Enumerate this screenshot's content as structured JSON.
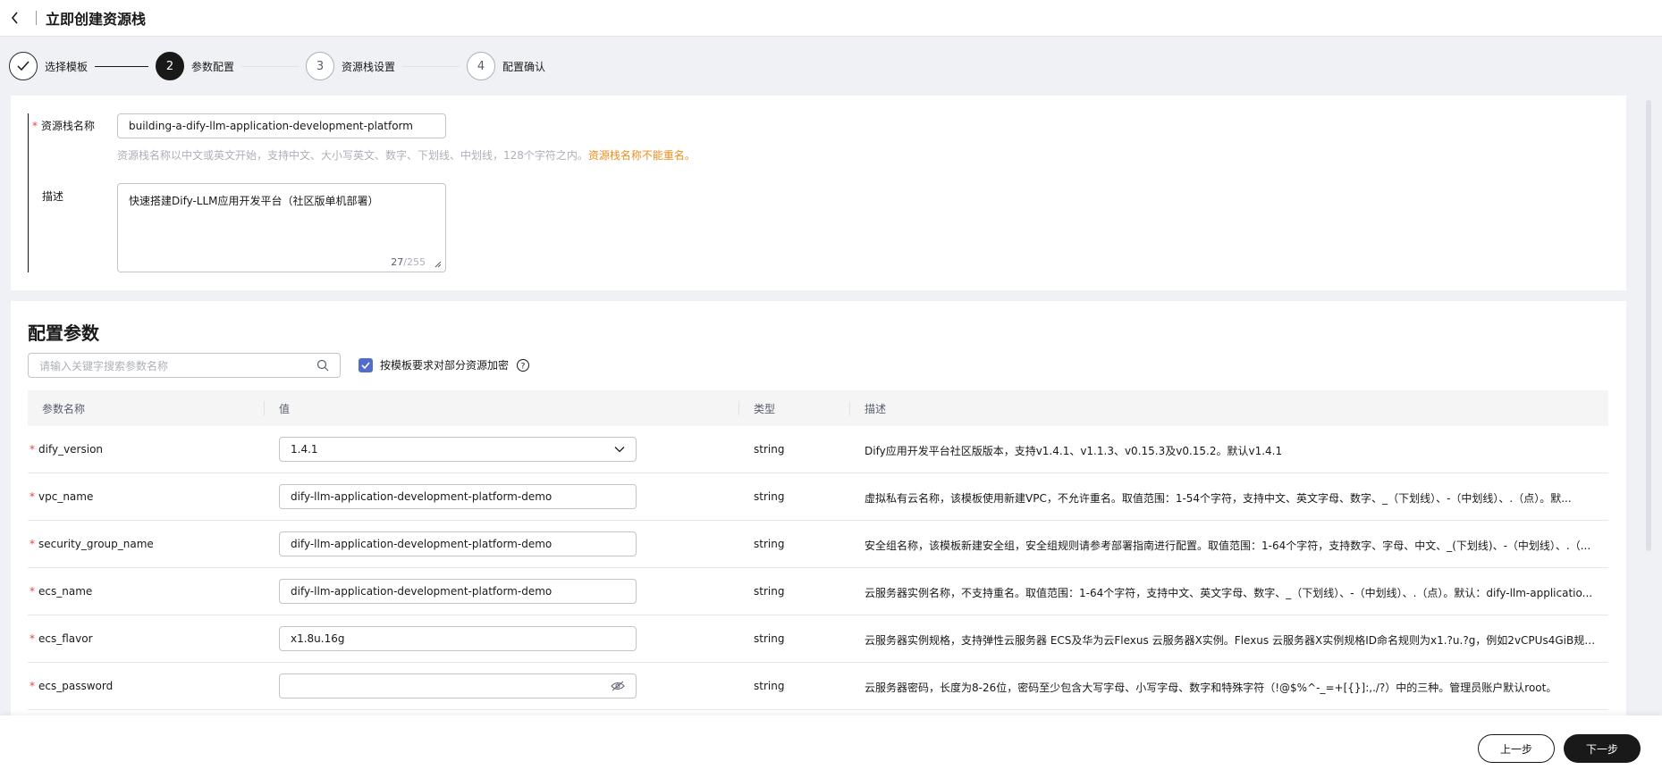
{
  "header": {
    "title": "立即创建资源栈"
  },
  "steps": [
    {
      "label": "选择模板",
      "num": ""
    },
    {
      "label": "参数配置",
      "num": "2"
    },
    {
      "label": "资源栈设置",
      "num": "3"
    },
    {
      "label": "配置确认",
      "num": "4"
    }
  ],
  "basic": {
    "name_label": "资源栈名称",
    "name_value": "building-a-dify-llm-application-development-platform",
    "name_hint": "资源栈名称以中文或英文开始，支持中文、大小写英文、数字、下划线、中划线，128个字符之内。",
    "name_hint_warn": "资源栈名称不能重名。",
    "desc_label": "描述",
    "desc_value": "快速搭建Dify-LLM应用开发平台（社区版单机部署）",
    "desc_count": "27",
    "desc_max": "/255"
  },
  "params": {
    "title": "配置参数",
    "search_placeholder": "请输入关键字搜索参数名称",
    "encrypt_label": "按模板要求对部分资源加密",
    "columns": {
      "name": "参数名称",
      "value": "值",
      "type": "类型",
      "desc": "描述"
    },
    "rows": [
      {
        "name": "dify_version",
        "value": "1.4.1",
        "type": "string",
        "desc": "Dify应用开发平台社区版版本，支持v1.4.1、v1.1.3、v0.15.3及v0.15.2。默认v1.4.1"
      },
      {
        "name": "vpc_name",
        "value": "dify-llm-application-development-platform-demo",
        "type": "string",
        "desc": "虚拟私有云名称，该模板使用新建VPC，不允许重名。取值范围：1-54个字符，支持中文、英文字母、数字、_（下划线）、-（中划线）、.（点）。默..."
      },
      {
        "name": "security_group_name",
        "value": "dify-llm-application-development-platform-demo",
        "type": "string",
        "desc": "安全组名称，该模板新建安全组，安全组规则请参考部署指南进行配置。取值范围：1-64个字符，支持数字、字母、中文、_(下划线)、-（中划线）、.（..."
      },
      {
        "name": "ecs_name",
        "value": "dify-llm-application-development-platform-demo",
        "type": "string",
        "desc": "云服务器实例名称，不支持重名。取值范围：1-64个字符，支持中文、英文字母、数字、_（下划线）、-（中划线）、.（点）。默认：dify-llm-applicatio..."
      },
      {
        "name": "ecs_flavor",
        "value": "x1.8u.16g",
        "type": "string",
        "desc": "云服务器实例规格，支持弹性云服务器 ECS及华为云Flexus 云服务器X实例。Flexus 云服务器X实例规格ID命名规则为x1.?u.?g，例如2vCPUs4GiB规格..."
      },
      {
        "name": "ecs_password",
        "value": "",
        "type": "string",
        "desc": "云服务器密码，长度为8-26位，密码至少包含大写字母、小写字母、数字和特殊字符（!@$%^-_=+[{}]:,./?）中的三种。管理员账户默认root。"
      }
    ]
  },
  "footer": {
    "prev": "上一步",
    "next": "下一步"
  }
}
